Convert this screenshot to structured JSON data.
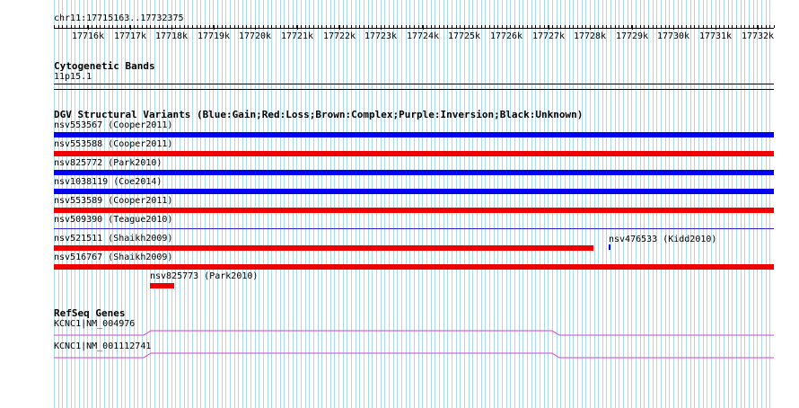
{
  "ruler": {
    "region": "chr11:17715163..17732375",
    "ticks": [
      "17716k",
      "17717k",
      "17718k",
      "17719k",
      "17720k",
      "17721k",
      "17722k",
      "17723k",
      "17724k",
      "17725k",
      "17726k",
      "17727k",
      "17728k",
      "17729k",
      "17730k",
      "17731k",
      "17732k"
    ]
  },
  "cytoband": {
    "title": "Cytogenetic Bands",
    "band": "11p15.1"
  },
  "dgv": {
    "title": "DGV Structural Variants (Blue:Gain;Red:Loss;Brown:Complex;Purple:Inversion;Black:Unknown)",
    "variants": [
      {
        "label": "nsv553567 (Cooper2011)",
        "type": "Gain"
      },
      {
        "label": "nsv553588 (Cooper2011)",
        "type": "Loss"
      },
      {
        "label": "nsv825772 (Park2010)",
        "type": "Gain"
      },
      {
        "label": "nsv1038119 (Coe2014)",
        "type": "Gain"
      },
      {
        "label": "nsv553589 (Cooper2011)",
        "type": "Loss"
      },
      {
        "label": "nsv509390 (Teague2010)",
        "type": "Gain"
      },
      {
        "label": "nsv521511 (Shaikh2009)",
        "type": "Loss"
      },
      {
        "label": "nsv476533 (Kidd2010)",
        "type": "Gain"
      },
      {
        "label": "nsv516767 (Shaikh2009)",
        "type": "Loss"
      },
      {
        "label": "nsv825773 (Park2010)",
        "type": "Loss"
      }
    ],
    "colors": {
      "gain": "#0000ee",
      "loss": "#ee0000",
      "thin": "#2222cc"
    }
  },
  "refseq": {
    "title": "RefSeq Genes",
    "genes": [
      {
        "label": "KCNC1|NM_004976"
      },
      {
        "label": "KCNC1|NM_001112741"
      }
    ],
    "color": "#cc44cc"
  },
  "grid_color": "#add8e6"
}
